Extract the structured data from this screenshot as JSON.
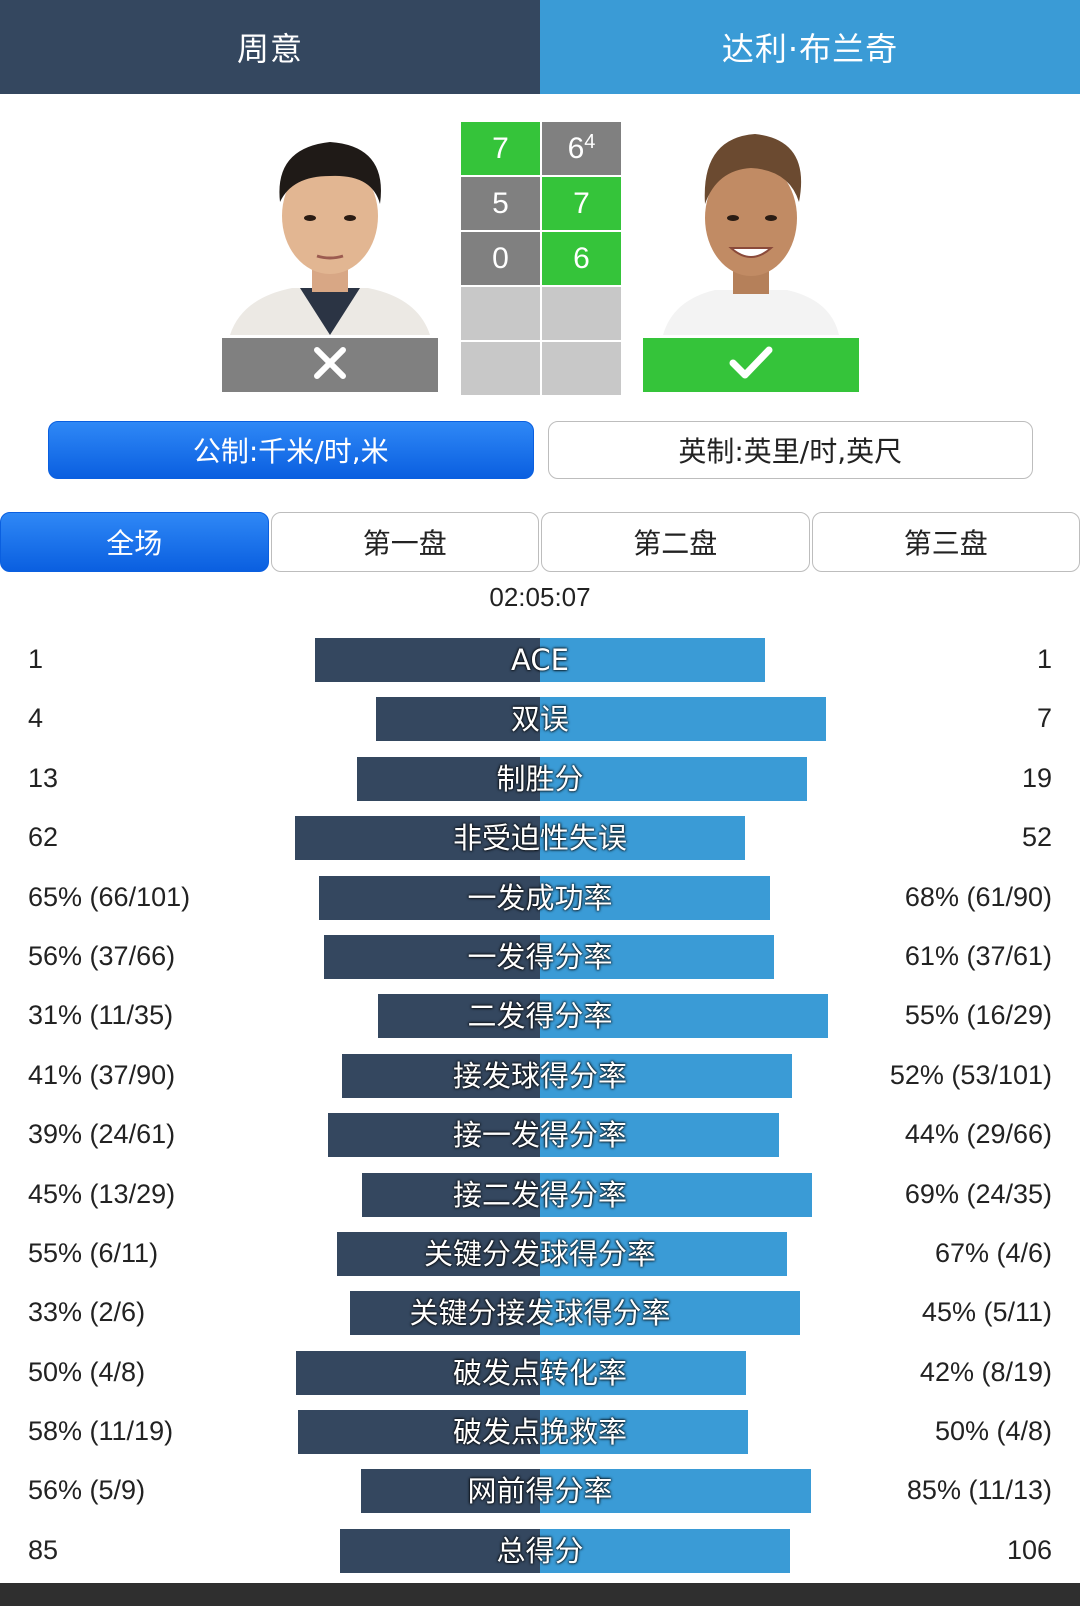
{
  "players": {
    "left": {
      "name": "周意",
      "result": "loss"
    },
    "right": {
      "name": "达利·布兰奇",
      "result": "win"
    }
  },
  "score": {
    "sets": [
      {
        "left": "7",
        "right": "6",
        "right_tiebreak": "4",
        "winner": "left"
      },
      {
        "left": "5",
        "right": "7",
        "winner": "right"
      },
      {
        "left": "0",
        "right": "6",
        "winner": "right"
      }
    ]
  },
  "units": {
    "metric": "公制:千米/时,米",
    "imperial": "英制:英里/时,英尺",
    "active": "metric"
  },
  "tabs": [
    {
      "label": "全场",
      "active": true
    },
    {
      "label": "第一盘",
      "active": false
    },
    {
      "label": "第二盘",
      "active": false
    },
    {
      "label": "第三盘",
      "active": false
    }
  ],
  "duration": "02:05:07",
  "stats": [
    {
      "label": "ACE",
      "left": "1",
      "right": "1",
      "left_ratio": 0.5,
      "right_ratio": 0.5
    },
    {
      "label": "双误",
      "left": "4",
      "right": "7",
      "left_ratio": 0.364,
      "right_ratio": 0.636
    },
    {
      "label": "制胜分",
      "left": "13",
      "right": "19",
      "left_ratio": 0.406,
      "right_ratio": 0.594
    },
    {
      "label": "非受迫性失误",
      "left": "62",
      "right": "52",
      "left_ratio": 0.544,
      "right_ratio": 0.456
    },
    {
      "label": "一发成功率",
      "left": "65% (66/101)",
      "right": "68% (61/90)",
      "left_ratio": 0.49,
      "right_ratio": 0.51
    },
    {
      "label": "一发得分率",
      "left": "56% (37/66)",
      "right": "61% (37/61)",
      "left_ratio": 0.479,
      "right_ratio": 0.521
    },
    {
      "label": "二发得分率",
      "left": "31% (11/35)",
      "right": "55% (16/29)",
      "left_ratio": 0.36,
      "right_ratio": 0.64
    },
    {
      "label": "接发球得分率",
      "left": "41% (37/90)",
      "right": "52% (53/101)",
      "left_ratio": 0.441,
      "right_ratio": 0.559
    },
    {
      "label": "接一发得分率",
      "left": "39% (24/61)",
      "right": "44% (29/66)",
      "left_ratio": 0.47,
      "right_ratio": 0.53
    },
    {
      "label": "接二发得分率",
      "left": "45% (13/29)",
      "right": "69% (24/35)",
      "left_ratio": 0.395,
      "right_ratio": 0.605
    },
    {
      "label": "关键分发球得分率",
      "left": "55% (6/11)",
      "right": "67% (4/6)",
      "left_ratio": 0.451,
      "right_ratio": 0.549
    },
    {
      "label": "关键分接发球得分率",
      "left": "33% (2/6)",
      "right": "45% (5/11)",
      "left_ratio": 0.423,
      "right_ratio": 0.577
    },
    {
      "label": "破发点转化率",
      "left": "50% (4/8)",
      "right": "42% (8/19)",
      "left_ratio": 0.543,
      "right_ratio": 0.457
    },
    {
      "label": "破发点挽救率",
      "left": "58% (11/19)",
      "right": "50% (4/8)",
      "left_ratio": 0.537,
      "right_ratio": 0.463
    },
    {
      "label": "网前得分率",
      "left": "56% (5/9)",
      "right": "85% (11/13)",
      "left_ratio": 0.397,
      "right_ratio": 0.603
    },
    {
      "label": "总得分",
      "left": "85",
      "right": "106",
      "left_ratio": 0.445,
      "right_ratio": 0.555
    }
  ],
  "colors": {
    "left": "#34475f",
    "right": "#3a9bd6",
    "win": "#35c43a",
    "loss": "#808080",
    "active_button": "#0a5fe0"
  }
}
